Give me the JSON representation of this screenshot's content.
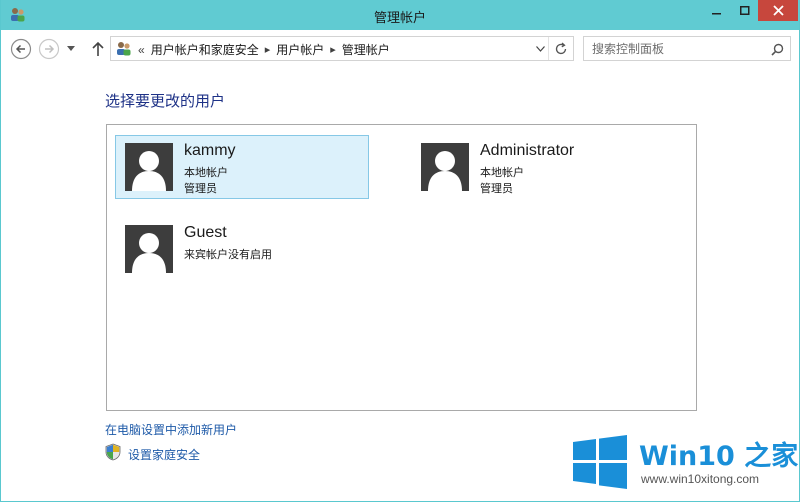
{
  "window": {
    "title": "管理帐户"
  },
  "nav": {
    "breadcrumb_lead": "«",
    "breadcrumbs": [
      "用户帐户和家庭安全",
      "用户帐户",
      "管理帐户"
    ],
    "search_placeholder": "搜索控制面板"
  },
  "main": {
    "heading": "选择要更改的用户",
    "users": [
      {
        "name": "kammy",
        "line1": "本地帐户",
        "line2": "管理员",
        "selected": true
      },
      {
        "name": "Administrator",
        "line1": "本地帐户",
        "line2": "管理员",
        "selected": false
      },
      {
        "name": "Guest",
        "line1": "来宾帐户没有启用",
        "line2": "",
        "selected": false
      }
    ],
    "add_user_link": "在电脑设置中添加新用户",
    "family_safety_link": "设置家庭安全"
  },
  "watermark": {
    "title": "Win10 之家",
    "url": "www.win10xitong.com"
  },
  "colors": {
    "titlebar": "#60cbd2",
    "close_button": "#c7473d",
    "heading": "#1e3287",
    "link": "#1e5aa8",
    "selected_bg": "#dcf1fb",
    "watermark_blue": "#1a8fd8"
  },
  "icons": {
    "app": "users-icon",
    "back": "back-arrow-icon",
    "forward": "forward-arrow-icon",
    "recent": "chevron-down-icon",
    "up": "up-arrow-icon",
    "refresh": "refresh-icon",
    "search": "search-icon",
    "shield": "shield-icon",
    "avatar": "user-avatar-icon"
  }
}
